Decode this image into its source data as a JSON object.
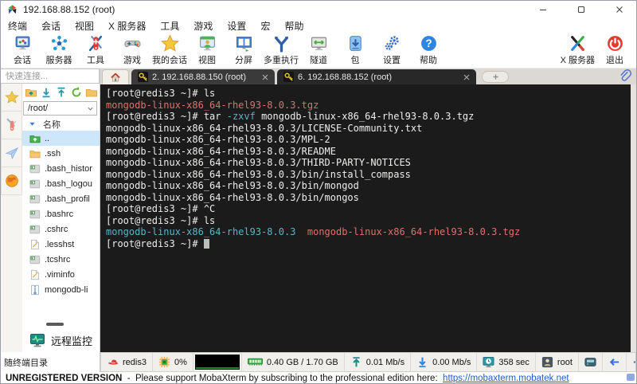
{
  "window": {
    "title": "192.168.88.152 (root)"
  },
  "menu": {
    "items": [
      "终端",
      "会话",
      "视图",
      "X 服务器",
      "工具",
      "游戏",
      "设置",
      "宏",
      "帮助"
    ]
  },
  "toolbar": {
    "items": [
      {
        "id": "session",
        "label": "会话"
      },
      {
        "id": "servers",
        "label": "服务器"
      },
      {
        "id": "tools",
        "label": "工具"
      },
      {
        "id": "games",
        "label": "游戏"
      },
      {
        "id": "mysessions",
        "label": "我的会话"
      },
      {
        "id": "view",
        "label": "视图"
      },
      {
        "id": "split",
        "label": "分屏"
      },
      {
        "id": "multiexec",
        "label": "多重执行"
      },
      {
        "id": "tunnel",
        "label": "隧道"
      },
      {
        "id": "packages",
        "label": "包"
      },
      {
        "id": "settings",
        "label": "设置"
      },
      {
        "id": "help",
        "label": "帮助"
      }
    ],
    "right_items": [
      {
        "id": "xserver",
        "label": "X 服务器"
      },
      {
        "id": "exit",
        "label": "退出"
      }
    ]
  },
  "sidebar": {
    "quick_connect": "快速连接...",
    "strip": [
      {
        "icon": "star"
      },
      {
        "icon": "knife"
      },
      {
        "icon": "paperplane"
      },
      {
        "icon": "globe"
      }
    ],
    "file_toolbar": [
      {
        "icon": "folder-up"
      },
      {
        "icon": "download"
      },
      {
        "icon": "upload"
      },
      {
        "icon": "refresh"
      },
      {
        "icon": "folder-plain"
      }
    ],
    "path": "/root/",
    "name_header": "名称",
    "files": [
      {
        "name": "..",
        "type": "parent",
        "selected": true
      },
      {
        "name": ".ssh",
        "type": "folder",
        "selected": false
      },
      {
        "name": ".bash_histor",
        "type": "script",
        "selected": false
      },
      {
        "name": ".bash_logou",
        "type": "script",
        "selected": false
      },
      {
        "name": ".bash_profil",
        "type": "script",
        "selected": false
      },
      {
        "name": ".bashrc",
        "type": "script",
        "selected": false
      },
      {
        "name": ".cshrc",
        "type": "script",
        "selected": false
      },
      {
        "name": ".lesshst",
        "type": "file",
        "selected": false
      },
      {
        "name": ".tcshrc",
        "type": "script",
        "selected": false
      },
      {
        "name": ".viminfo",
        "type": "file",
        "selected": false
      },
      {
        "name": "mongodb-li",
        "type": "zip",
        "selected": false
      }
    ],
    "remote_monitor": "远程监控",
    "follow_dir": "随终端目录"
  },
  "tabs": {
    "items": [
      {
        "label": "2. 192.168.88.150 (root)",
        "active": false
      },
      {
        "label": "6. 192.168.88.152 (root)",
        "active": true
      }
    ]
  },
  "terminal": {
    "lines": [
      {
        "segments": [
          {
            "t": "[root@redis3 ~]# ls",
            "c": "fg"
          }
        ]
      },
      {
        "segments": [
          {
            "t": "mongodb-linux-x86_64-rhel93-8.0.3.tgz",
            "c": "red"
          }
        ]
      },
      {
        "segments": [
          {
            "t": "[root@redis3 ~]# tar ",
            "c": "fg"
          },
          {
            "t": "-zxvf",
            "c": "cyan"
          },
          {
            "t": " mongodb-linux-x86_64-rhel93-8.0.3.tgz",
            "c": "fg"
          }
        ]
      },
      {
        "segments": [
          {
            "t": "mongodb-linux-x86_64-rhel93-8.0.3/LICENSE-Community.txt",
            "c": "fg"
          }
        ]
      },
      {
        "segments": [
          {
            "t": "mongodb-linux-x86_64-rhel93-8.0.3/MPL-2",
            "c": "fg"
          }
        ]
      },
      {
        "segments": [
          {
            "t": "mongodb-linux-x86_64-rhel93-8.0.3/README",
            "c": "fg"
          }
        ]
      },
      {
        "segments": [
          {
            "t": "mongodb-linux-x86_64-rhel93-8.0.3/THIRD-PARTY-NOTICES",
            "c": "fg"
          }
        ]
      },
      {
        "segments": [
          {
            "t": "mongodb-linux-x86_64-rhel93-8.0.3/bin/install_compass",
            "c": "fg"
          }
        ]
      },
      {
        "segments": [
          {
            "t": "mongodb-linux-x86_64-rhel93-8.0.3/bin/mongod",
            "c": "fg"
          }
        ]
      },
      {
        "segments": [
          {
            "t": "mongodb-linux-x86_64-rhel93-8.0.3/bin/mongos",
            "c": "fg"
          }
        ]
      },
      {
        "segments": [
          {
            "t": "[root@redis3 ~]# ^C",
            "c": "fg"
          }
        ]
      },
      {
        "segments": [
          {
            "t": "[root@redis3 ~]# ls",
            "c": "fg"
          }
        ]
      },
      {
        "segments": [
          {
            "t": "mongodb-linux-x86_64-rhel93-8.0.3",
            "c": "cyan"
          },
          {
            "t": "  ",
            "c": "fg"
          },
          {
            "t": "mongodb-linux-x86_64-rhel93-8.0.3.tgz",
            "c": "red"
          }
        ]
      },
      {
        "segments": [
          {
            "t": "[root@redis3 ~]# ",
            "c": "fg"
          },
          {
            "t": " ",
            "c": "cursor"
          }
        ]
      }
    ]
  },
  "status_bar": {
    "items": [
      {
        "icon": "redhat",
        "label": "redis3"
      },
      {
        "icon": "cpu",
        "label": "0%"
      },
      {
        "icon": "graph",
        "label": ""
      },
      {
        "icon": "ram",
        "label": "0.40 GB / 1.70 GB"
      },
      {
        "icon": "up",
        "label": "0.01 Mb/s"
      },
      {
        "icon": "down",
        "label": "0.00 Mb/s"
      },
      {
        "icon": "timer",
        "label": "358 sec"
      },
      {
        "icon": "user",
        "label": "root"
      },
      {
        "icon": "drive",
        "label": ""
      },
      {
        "icon": "arrow-left",
        "label": ""
      },
      {
        "icon": "arrow-right",
        "label": ""
      },
      {
        "icon": "close-red",
        "label": ""
      }
    ]
  },
  "footer": {
    "bold": "UNREGISTERED VERSION",
    "text": "  -  Please support MobaXterm by subscribing to the professional edition here:  ",
    "link": "https://mobaxterm.mobatek.net"
  },
  "colors": {
    "terminal_bg": "#1b1b1b",
    "terminal_fg": "#eeeeec",
    "terminal_red": "#d9736d",
    "terminal_cyan": "#57b6c6",
    "selection_blue": "#cde6fa"
  }
}
